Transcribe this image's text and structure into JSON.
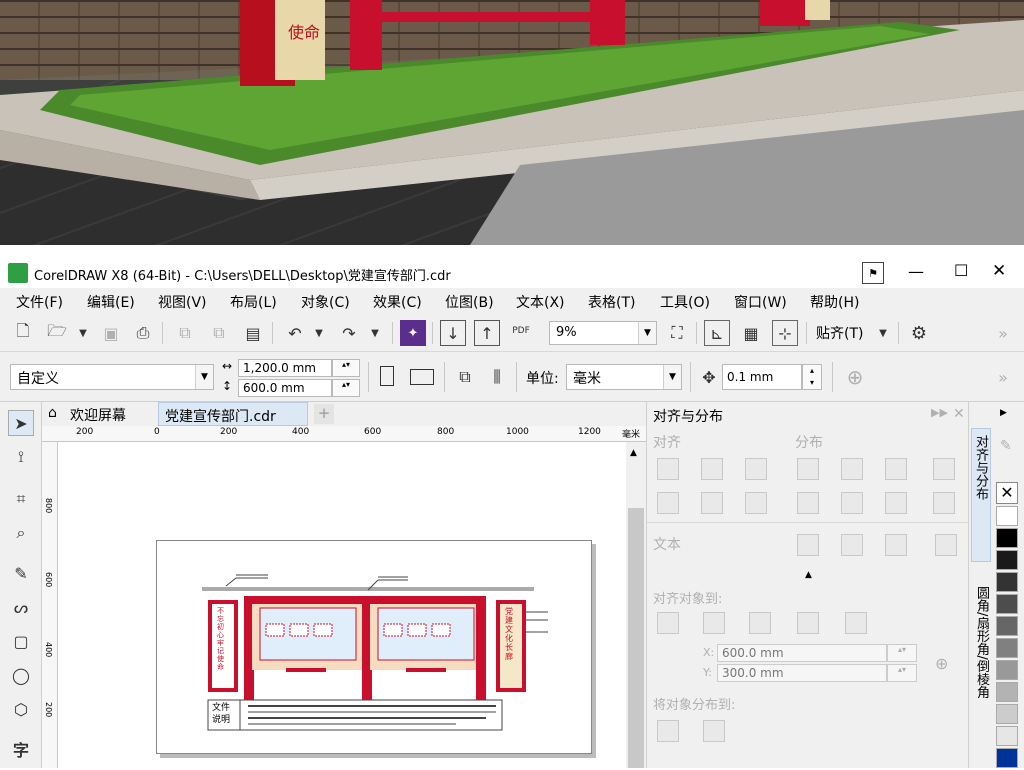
{
  "window": {
    "title": "CorelDRAW X8 (64-Bit) - C:\\Users\\DELL\\Desktop\\党建宣传部门.cdr",
    "minimize": "—",
    "maximize": "☐",
    "close": "✕"
  },
  "menu": [
    "文件(F)",
    "编辑(E)",
    "视图(V)",
    "布局(L)",
    "对象(C)",
    "效果(C)",
    "位图(B)",
    "文本(X)",
    "表格(T)",
    "工具(O)",
    "窗口(W)",
    "帮助(H)"
  ],
  "toolbar": {
    "zoom": "9%",
    "snap_label": "贴齐(T)",
    "pdf": "PDF"
  },
  "propbar": {
    "preset": "自定义",
    "width": "1,200.0 mm",
    "height": "600.0 mm",
    "unit_label": "单位:",
    "unit": "毫米",
    "nudge": "0.1 mm"
  },
  "tabs": {
    "welcome": "欢迎屏幕",
    "doc": "党建宣传部门.cdr",
    "add": "+"
  },
  "ruler": {
    "labels": [
      "200",
      "0",
      "200",
      "400",
      "600",
      "800",
      "1000",
      "1200"
    ],
    "unit": "毫米",
    "vlabels": [
      "800",
      "600",
      "400",
      "200"
    ]
  },
  "design": {
    "left_sign": "不忘初心 牢记使命",
    "right_sign": "党建文化长廊",
    "note": "文件\n说明"
  },
  "docker": {
    "title": "对齐与分布",
    "align": "对齐",
    "distribute": "分布",
    "text": "文本",
    "align_to": "对齐对象到:",
    "x": "600.0 mm",
    "y": "300.0 mm",
    "distribute_to": "将对象分布到:",
    "x_label": "X:",
    "y_label": "Y:"
  },
  "vtabs": [
    "对齐与分布",
    "圆角/扇形角/倒棱角"
  ],
  "colors": {
    "accent_red": "#c8102e",
    "chrome": "#f0f0f0",
    "corel_green": "#2ea043"
  },
  "palette": [
    "#ffffff",
    "#000000",
    "#1a1a1a",
    "#333333",
    "#4d4d4d",
    "#666666",
    "#808080",
    "#999999",
    "#b3b3b3",
    "#cccccc",
    "#e6e6e6",
    "#003399"
  ]
}
